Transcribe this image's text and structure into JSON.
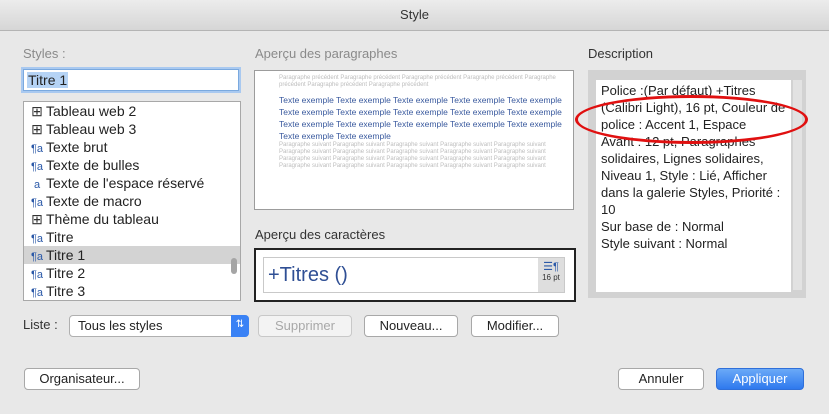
{
  "window": {
    "title": "Style"
  },
  "styles_panel": {
    "label": "Styles :",
    "name_value": "Titre 1",
    "items": [
      {
        "icon": "table-icon",
        "glyph": "⊞",
        "label": "Tableau web 2"
      },
      {
        "icon": "table-icon",
        "glyph": "⊞",
        "label": "Tableau web 3"
      },
      {
        "icon": "paragraph-style-icon",
        "glyph": "¶a",
        "label": "Texte brut"
      },
      {
        "icon": "paragraph-style-icon",
        "glyph": "¶a",
        "label": "Texte de bulles"
      },
      {
        "icon": "character-style-icon",
        "glyph": "a",
        "label": "Texte de l'espace réservé"
      },
      {
        "icon": "paragraph-style-icon",
        "glyph": "¶a",
        "label": "Texte de macro"
      },
      {
        "icon": "table-icon",
        "glyph": "⊞",
        "label": "Thème du tableau"
      },
      {
        "icon": "paragraph-style-icon",
        "glyph": "¶a",
        "label": "Titre"
      },
      {
        "icon": "paragraph-style-icon",
        "glyph": "¶a",
        "label": "Titre 1"
      },
      {
        "icon": "paragraph-style-icon",
        "glyph": "¶a",
        "label": "Titre 2"
      },
      {
        "icon": "paragraph-style-icon",
        "glyph": "¶a",
        "label": "Titre 3"
      }
    ],
    "selected_index": 8
  },
  "paragraph_preview": {
    "label": "Aperçu des paragraphes",
    "prev_text": "Paragraphe précédent Paragraphe précédent Paragraphe précédent Paragraphe précédent Paragraphe précédent Paragraphe précédent Paragraphe précédent",
    "sample_text": "Texte exemple Texte exemple Texte exemple Texte exemple Texte exemple Texte exemple Texte exemple Texte exemple Texte exemple Texte exemple Texte exemple Texte exemple Texte exemple Texte exemple Texte exemple Texte exemple Texte exemple",
    "next_text": "Paragraphe suivant Paragraphe suivant Paragraphe suivant Paragraphe suivant Paragraphe suivant Paragraphe suivant Paragraphe suivant Paragraphe suivant Paragraphe suivant Paragraphe suivant Paragraphe suivant Paragraphe suivant Paragraphe suivant Paragraphe suivant Paragraphe suivant Paragraphe suivant Paragraphe suivant Paragraphe suivant Paragraphe suivant Paragraphe suivant"
  },
  "character_preview": {
    "label": "Aperçu des caractères",
    "text": "+Titres ()",
    "badge_glyph": "☰¶",
    "size": "16 pt"
  },
  "description": {
    "label": "Description",
    "text": "Police :(Par défaut) +Titres (Calibri Light), 16 pt, Couleur de police : Accent 1, Espace\n    Avant : 12 pt, Paragraphes solidaires, Lignes solidaires, Niveau 1, Style : Lié, Afficher dans la galerie Styles, Priorité : 10\n    Sur base de : Normal\n    Style suivant : Normal"
  },
  "list_filter": {
    "label": "Liste :",
    "value": "Tous les styles",
    "arrows": "⇅"
  },
  "buttons": {
    "delete": "Supprimer",
    "new": "Nouveau...",
    "modify": "Modifier...",
    "organizer": "Organisateur...",
    "cancel": "Annuler",
    "apply": "Appliquer"
  },
  "colors": {
    "accent": "#3a82f5",
    "annotation": "#e01010",
    "heading_text": "#2f4f94"
  }
}
